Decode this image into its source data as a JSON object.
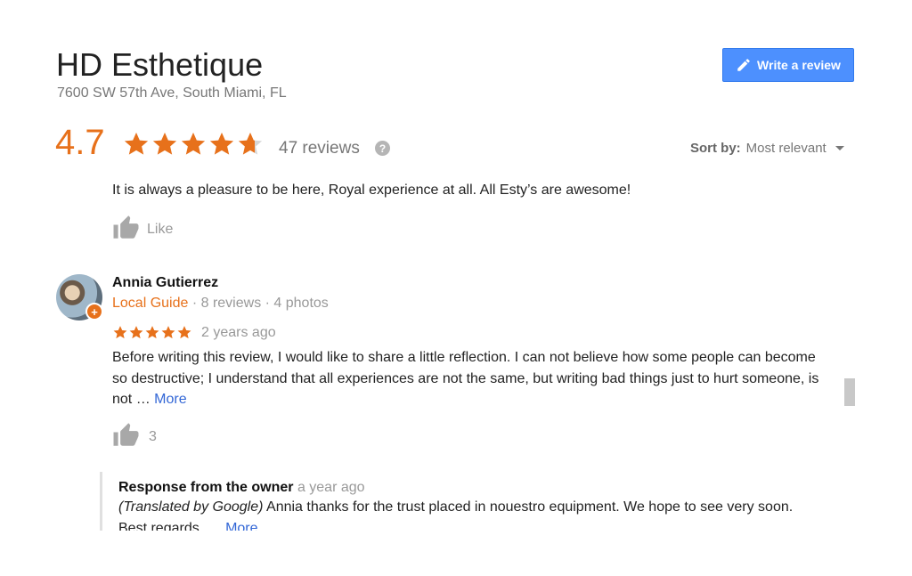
{
  "business": {
    "name": "HD Esthetique",
    "address": "7600 SW 57th Ave, South Miami, FL"
  },
  "actions": {
    "write_review": "Write a review"
  },
  "summary": {
    "rating": "4.7",
    "rating_value": 4.7,
    "reviews": "47 reviews",
    "help": "?"
  },
  "sort": {
    "label": "Sort by:",
    "value": "Most relevant"
  },
  "review_prev": {
    "text": "It is always a pleasure to be here, Royal experience at all.  All Esty’s are awesome!",
    "like_label": "Like"
  },
  "review": {
    "author": "Annia Gutierrez",
    "local_guide": "Local Guide",
    "meta": " · 8 reviews · 4 photos",
    "stars": 5,
    "time": "2 years ago",
    "text": "Before writing this review, I would like to share a little reflection. I can not believe how some people  can become so destructive; I understand that all experiences are not the same, but writing bad things just to hurt someone, is not …",
    "more": "More",
    "likes": "3"
  },
  "owner_response": {
    "title": "Response from the owner",
    "time": "a year ago",
    "translated": "(Translated by Google)",
    "text": " Annia thanks for the trust placed in nouestro equipment. We hope to see very soon. Best regards, …",
    "more": "More"
  },
  "colors": {
    "accent": "#e7711b",
    "button": "#4d90fe",
    "link": "#3367d6"
  }
}
